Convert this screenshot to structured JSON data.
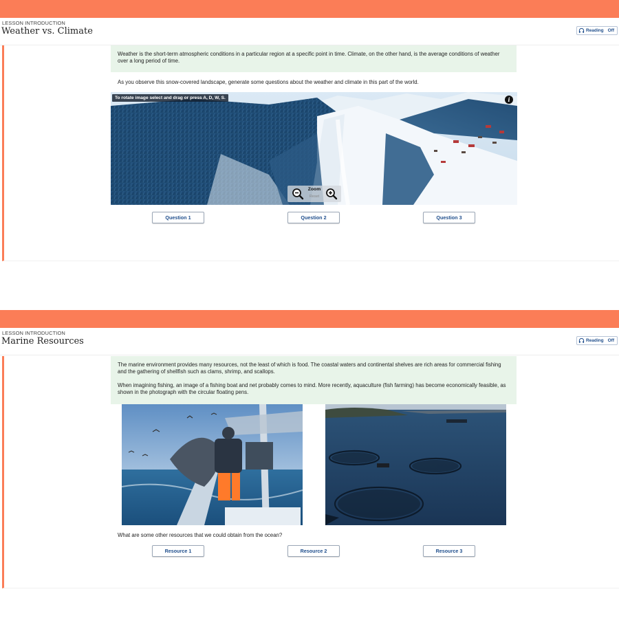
{
  "colors": {
    "accent": "#fb7d57",
    "callout_bg": "#e8f4e9",
    "button_text": "#1f4e8c"
  },
  "lessons": [
    {
      "kicker": "LESSON INTRODUCTION",
      "title": "Weather vs. Climate",
      "reading": {
        "label": "Reading",
        "state": "Off",
        "icon": "headphones-icon"
      },
      "callout": [
        "Weather is the short-term atmospheric conditions in a particular region at a specific point in time. Climate, on the other hand, is the average conditions of weather over a long period of time."
      ],
      "prompt": "As you observe this snow-covered landscape, generate some questions about the weather and climate in this part of the world.",
      "panorama": {
        "instruction": "To rotate image select and drag or press A, D, W, S.",
        "info_icon": "info-icon",
        "zoom_label": "Zoom",
        "reset_label": "Reset"
      },
      "buttons": [
        "Question 1",
        "Question 2",
        "Question 3"
      ]
    },
    {
      "kicker": "LESSON INTRODUCTION",
      "title": "Marine Resources",
      "reading": {
        "label": "Reading",
        "state": "Off",
        "icon": "headphones-icon"
      },
      "callout": [
        "The marine environment provides many resources, not the least of which is food. The coastal waters and continental shelves are rich areas for commercial fishing and the gathering of shellfish such as clams, shrimp, and scallops.",
        "When imagining fishing, an image of a fishing boat and net probably comes to mind. More recently, aquaculture (fish farming) has become economically feasible, as shown in the photograph with the circular floating pens."
      ],
      "prompt": "What are some other resources that we could obtain from the ocean?",
      "buttons": [
        "Resource 1",
        "Resource 2",
        "Resource 3"
      ]
    }
  ]
}
